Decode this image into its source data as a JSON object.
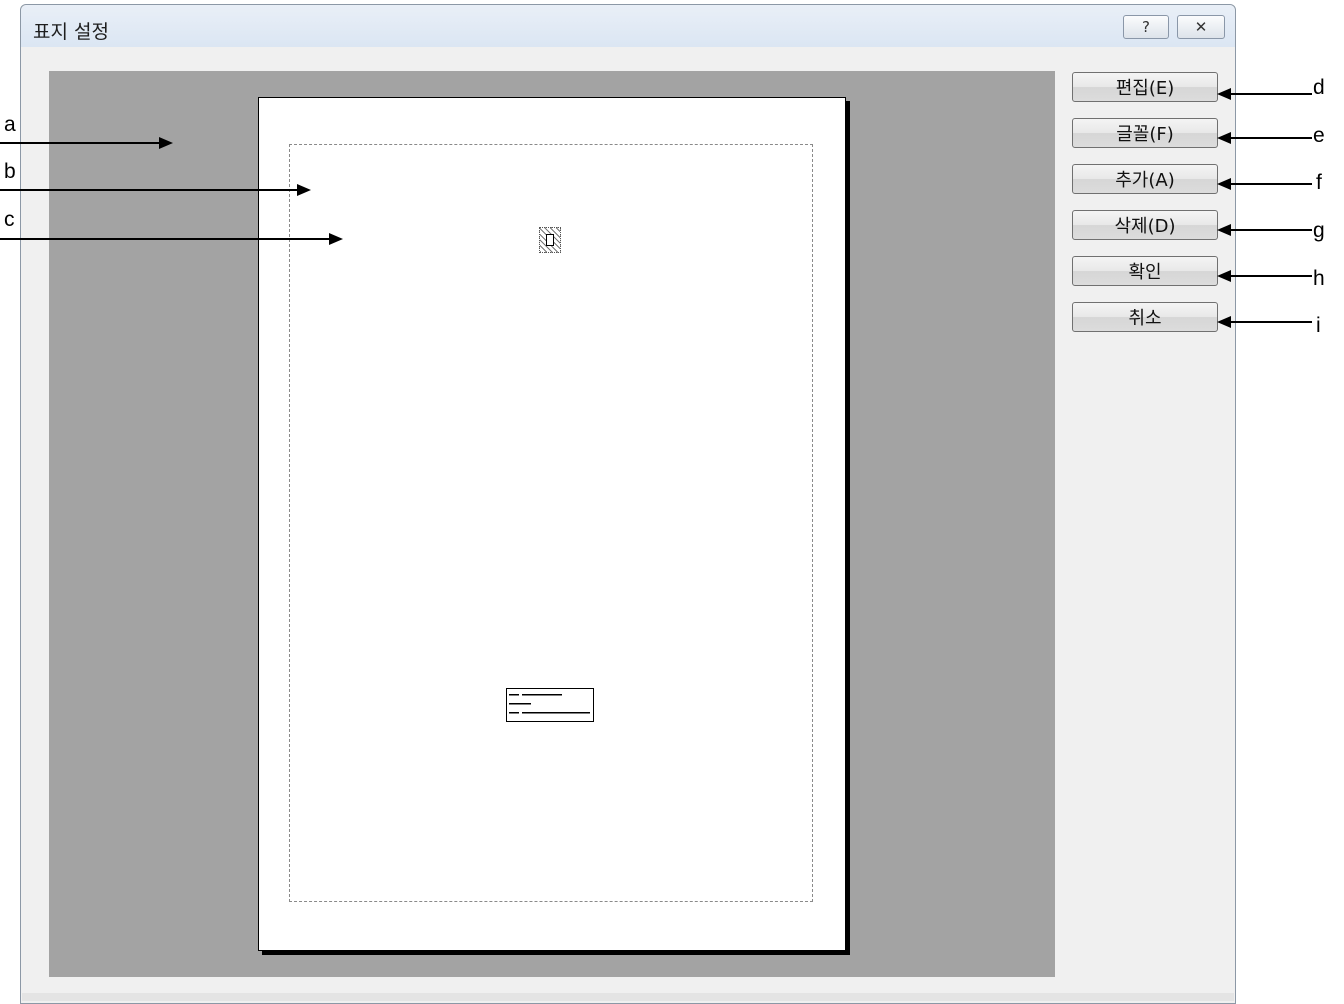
{
  "window": {
    "title": "표지 설정",
    "help_glyph": "?",
    "close_glyph": "✕"
  },
  "buttons": {
    "edit": "편집(E)",
    "font": "글꼴(F)",
    "add": "추가(A)",
    "delete": "삭제(D)",
    "ok": "확인",
    "cancel": "취소"
  },
  "callouts": {
    "a": "a",
    "b": "b",
    "c": "c",
    "d": "d",
    "e": "e",
    "f": "f",
    "g": "g",
    "h": "h",
    "i": "i"
  }
}
